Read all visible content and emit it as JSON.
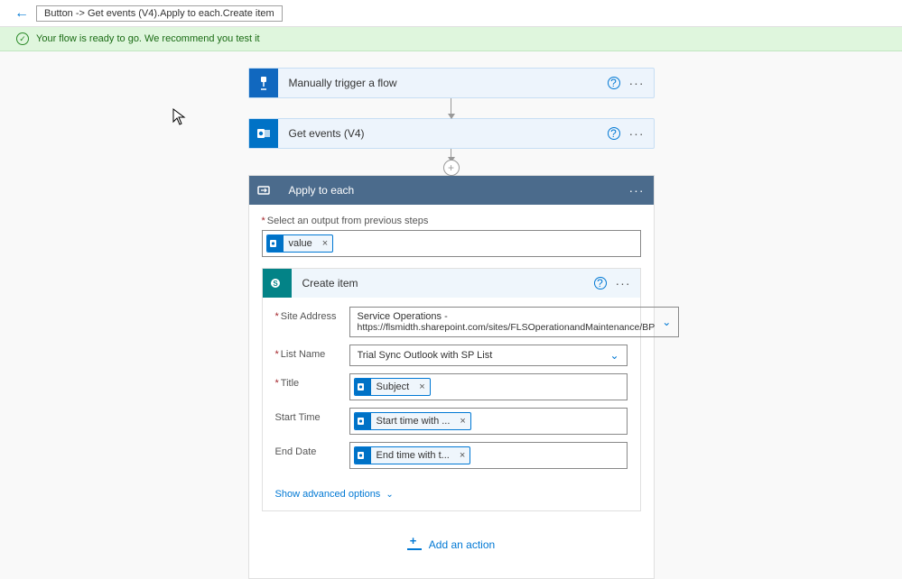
{
  "header": {
    "breadcrumb": "Button -> Get events (V4).Apply to each.Create item"
  },
  "success": {
    "message": "Your flow is ready to go. We recommend you test it"
  },
  "steps": {
    "trigger": {
      "title": "Manually trigger a flow"
    },
    "getEvents": {
      "title": "Get events (V4)"
    },
    "applyEach": {
      "title": "Apply to each",
      "outputLabel": "Select an output from previous steps",
      "outputToken": "value"
    },
    "createItem": {
      "title": "Create item",
      "fields": {
        "siteAddress": {
          "label": "Site Address",
          "value1": "Service Operations -",
          "value2": "https://flsmidth.sharepoint.com/sites/FLSOperationandMaintenance/BP"
        },
        "listName": {
          "label": "List Name",
          "value": "Trial Sync Outlook with SP List"
        },
        "title": {
          "label": "Title",
          "token": "Subject"
        },
        "startTime": {
          "label": "Start Time",
          "token": "Start time with ..."
        },
        "endDate": {
          "label": "End Date",
          "token": "End time with t..."
        }
      },
      "advanced": "Show advanced options"
    },
    "addAction": "Add an action"
  }
}
